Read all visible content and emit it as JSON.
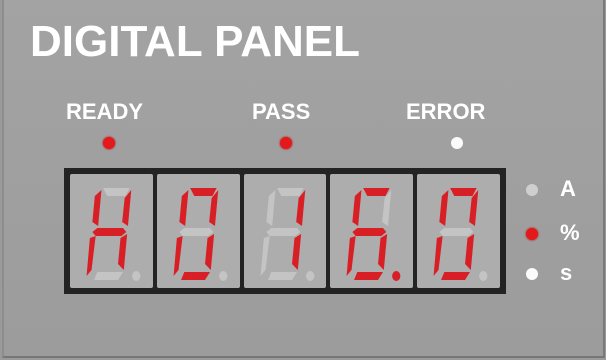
{
  "panel": {
    "title": "DIGITAL PANEL",
    "indicators": [
      {
        "label": "READY",
        "state": "on",
        "color": "#e3191c"
      },
      {
        "label": "PASS",
        "state": "on",
        "color": "#e3191c"
      },
      {
        "label": "ERROR",
        "state": "off",
        "color": "#ffffff"
      }
    ],
    "display": {
      "text": "H0.16.0",
      "digits": [
        {
          "char": "H",
          "dp": false
        },
        {
          "char": "0",
          "dp": false
        },
        {
          "char": "1",
          "dp": false
        },
        {
          "char": "6",
          "dp": true
        },
        {
          "char": "0",
          "dp": false
        }
      ],
      "segment_on_color": "#d91f26",
      "segment_off_color": "#c4c4c4"
    },
    "units": [
      {
        "label": "A",
        "active": false
      },
      {
        "label": "%",
        "active": true
      },
      {
        "label": "s",
        "active": false
      }
    ]
  }
}
